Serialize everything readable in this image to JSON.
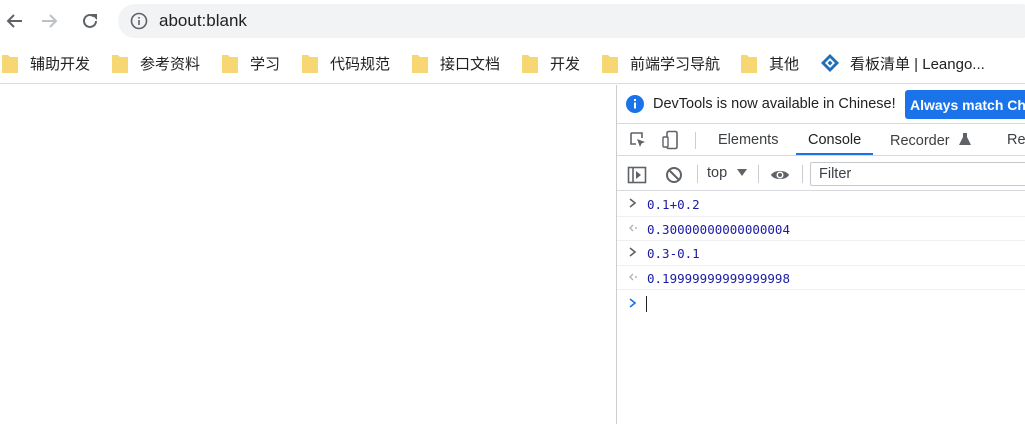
{
  "address_bar": {
    "url": "about:blank"
  },
  "bookmarks": [
    {
      "label": "辅助开发",
      "icon": "folder-icon"
    },
    {
      "label": "参考资料",
      "icon": "folder-icon"
    },
    {
      "label": "学习",
      "icon": "folder-icon"
    },
    {
      "label": "代码规范",
      "icon": "folder-icon"
    },
    {
      "label": "接口文档",
      "icon": "folder-icon"
    },
    {
      "label": "开发",
      "icon": "folder-icon"
    },
    {
      "label": "前端学习导航",
      "icon": "folder-icon"
    },
    {
      "label": "其他",
      "icon": "folder-icon"
    },
    {
      "label": "看板清单 | Leango...",
      "icon": "leangoo-logo-icon"
    }
  ],
  "devtools": {
    "infobar": {
      "message": "DevTools is now available in Chinese!",
      "button": "Always match Ch"
    },
    "tabs": [
      {
        "label": "Elements",
        "active": false
      },
      {
        "label": "Console",
        "active": true
      },
      {
        "label": "Recorder",
        "active": false
      },
      {
        "label": "Re",
        "active": false
      }
    ],
    "console_toolbar": {
      "context": "top",
      "filter_placeholder": "Filter"
    },
    "console_lines": [
      {
        "kind": "input",
        "text": "0.1+0.2"
      },
      {
        "kind": "output",
        "text": "0.30000000000000004"
      },
      {
        "kind": "input",
        "text": "0.3-0.1"
      },
      {
        "kind": "output",
        "text": "0.19999999999999998"
      }
    ]
  },
  "colors": {
    "accent": "#1a73e8",
    "folder": "#f7d774",
    "console_value": "#1a1aa6"
  }
}
